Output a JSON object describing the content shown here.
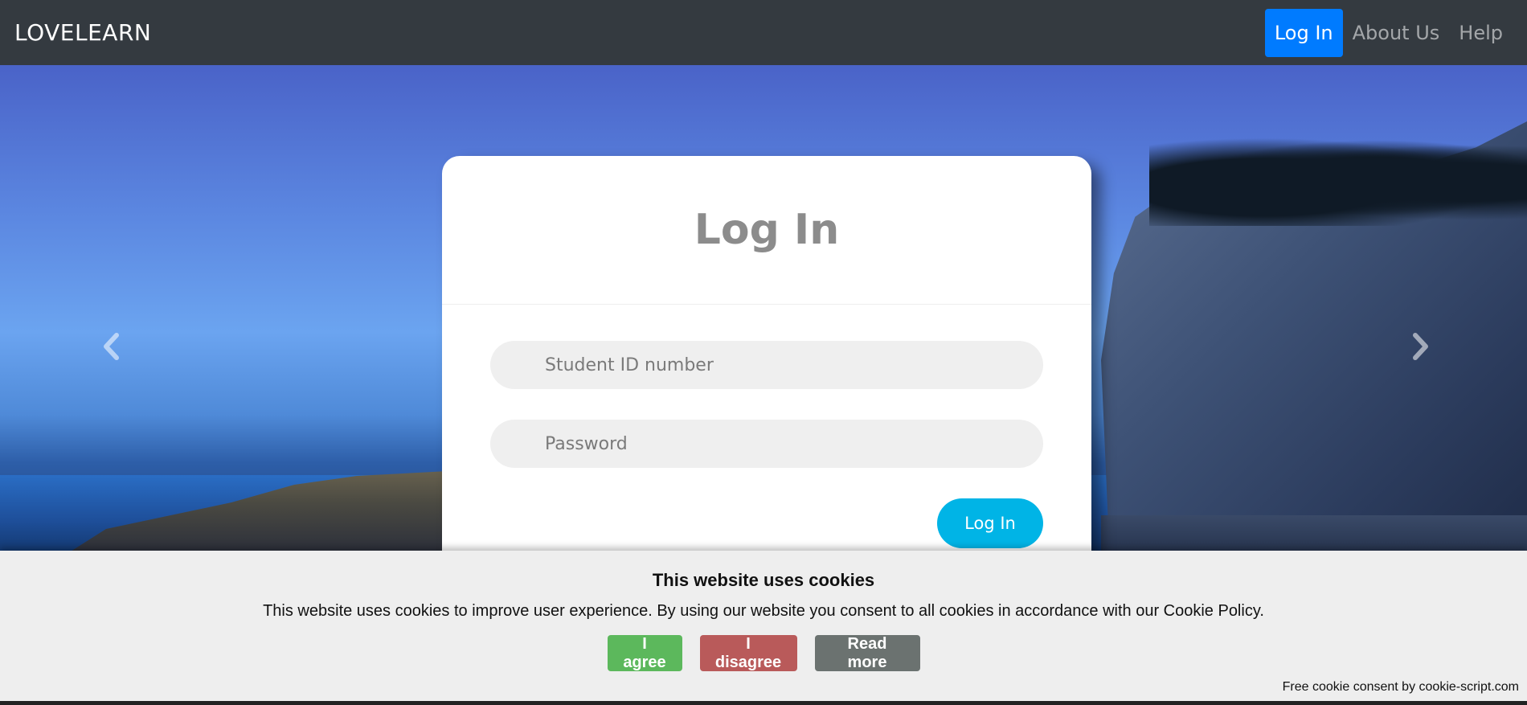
{
  "navbar": {
    "brand": "LOVELEARN",
    "items": [
      {
        "label": "Log In",
        "active": true
      },
      {
        "label": "About Us",
        "active": false
      },
      {
        "label": "Help",
        "active": false
      }
    ]
  },
  "carousel": {
    "prev_icon": "chevron-left-icon",
    "next_icon": "chevron-right-icon"
  },
  "login": {
    "title": "Log In",
    "student_id_placeholder": "Student ID number",
    "password_placeholder": "Password",
    "submit_label": "Log In"
  },
  "cookie": {
    "title": "This website uses cookies",
    "text": "This website uses cookies to improve user experience. By using our website you consent to all cookies in accordance with our Cookie Policy.",
    "agree_label": "I agree",
    "disagree_label": "I disagree",
    "read_more_label": "Read more",
    "credit": "Free cookie consent by cookie-script.com"
  },
  "colors": {
    "navbar_bg": "#343a40",
    "active_nav": "#007bff",
    "submit_button": "#00b4e6",
    "agree": "#5cb85c",
    "disagree": "#b95a5a",
    "read_more": "#6b7270"
  }
}
